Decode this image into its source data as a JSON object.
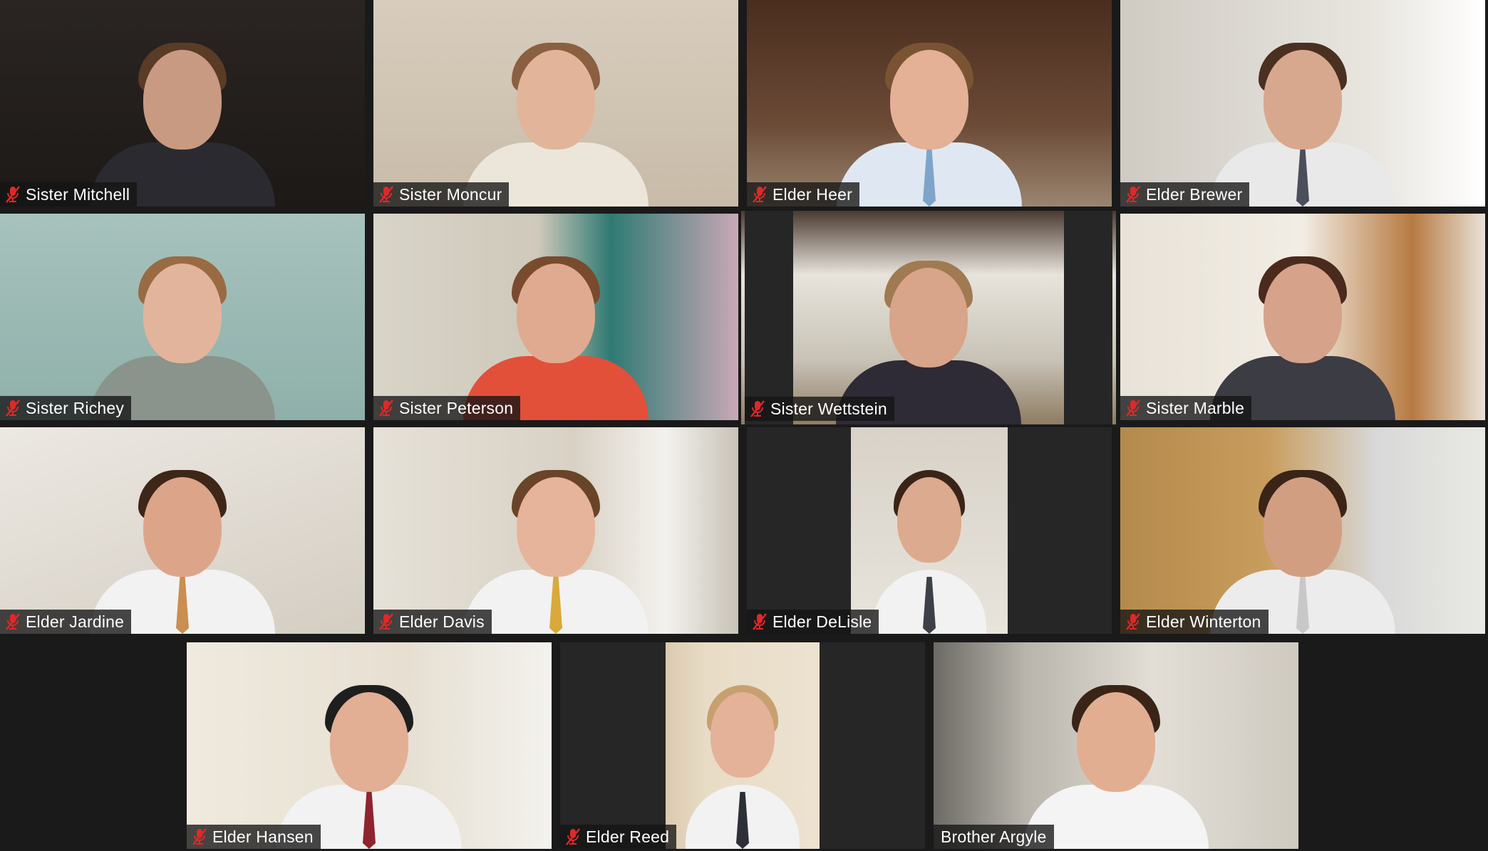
{
  "participants": [
    {
      "name": "Sister Mitchell",
      "muted": true,
      "icon": "mic-muted-icon"
    },
    {
      "name": "Sister Moncur",
      "muted": true,
      "icon": "mic-muted-icon"
    },
    {
      "name": "Elder Heer",
      "muted": true,
      "icon": "mic-muted-icon"
    },
    {
      "name": "Elder Brewer",
      "muted": true,
      "icon": "mic-muted-icon"
    },
    {
      "name": "Sister Richey",
      "muted": true,
      "icon": "mic-muted-icon"
    },
    {
      "name": "Sister Peterson",
      "muted": true,
      "icon": "mic-muted-icon"
    },
    {
      "name": "Sister Wettstein",
      "muted": true,
      "icon": "mic-muted-icon",
      "active_speaker": true
    },
    {
      "name": "Sister Marble",
      "muted": true,
      "icon": "mic-muted-icon"
    },
    {
      "name": "Elder Jardine",
      "muted": true,
      "icon": "mic-muted-icon"
    },
    {
      "name": "Elder Davis",
      "muted": true,
      "icon": "mic-muted-icon"
    },
    {
      "name": "Elder DeLisle",
      "muted": true,
      "icon": "mic-muted-icon"
    },
    {
      "name": "Elder Winterton",
      "muted": true,
      "icon": "mic-muted-icon"
    },
    {
      "name": "Elder Hansen",
      "muted": true,
      "icon": "mic-muted-icon"
    },
    {
      "name": "Elder Reed",
      "muted": true,
      "icon": "mic-muted-icon"
    },
    {
      "name": "Brother Argyle",
      "muted": false
    }
  ],
  "colors": {
    "background": "#1a1a1a",
    "active_speaker_border": "#e8e27a",
    "muted_icon": "#e02828",
    "label_text": "#ffffff"
  }
}
